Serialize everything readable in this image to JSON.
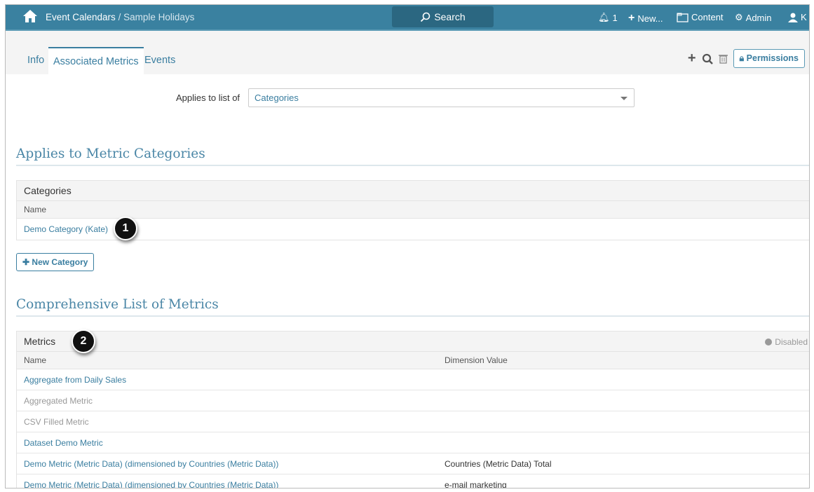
{
  "nav": {
    "breadcrumb_root": "Event Calendars",
    "breadcrumb_sep": " / ",
    "breadcrumb_current": "Sample Holidays",
    "search_label": "Search",
    "notifications_count": "1",
    "new_label": "New...",
    "content_label": "Content",
    "admin_label": "Admin",
    "user_initial": "K"
  },
  "tabs": [
    {
      "label": "Info"
    },
    {
      "label": "Associated Metrics"
    },
    {
      "label": "Events"
    }
  ],
  "toolbar": {
    "permissions_label": "Permissions"
  },
  "applies": {
    "label": "Applies to list of",
    "selected": "Categories"
  },
  "categories_section": {
    "title": "Applies to Metric Categories",
    "panel_title": "Categories",
    "col_name": "Name",
    "rows": [
      {
        "name": "Demo Category (Kate)"
      }
    ],
    "new_button": "New Category",
    "callout": "1"
  },
  "metrics_section": {
    "title": "Comprehensive List of Metrics",
    "panel_title": "Metrics",
    "legend_disabled": "Disabled",
    "col_name": "Name",
    "col_dimension": "Dimension Value",
    "callout": "2",
    "rows": [
      {
        "name": "Aggregate from Daily Sales",
        "dimension": "",
        "disabled": false
      },
      {
        "name": "Aggregated Metric",
        "dimension": "",
        "disabled": true
      },
      {
        "name": "CSV Filled Metric",
        "dimension": "",
        "disabled": true
      },
      {
        "name": "Dataset Demo Metric",
        "dimension": "",
        "disabled": false
      },
      {
        "name": "Demo Metric (Metric Data) (dimensioned by Countries (Metric Data))",
        "dimension": "Countries (Metric Data) Total",
        "disabled": false
      },
      {
        "name": "Demo Metric (Metric Data) (dimensioned by Countries (Metric Data))",
        "dimension": "e-mail marketing",
        "disabled": false
      }
    ]
  }
}
